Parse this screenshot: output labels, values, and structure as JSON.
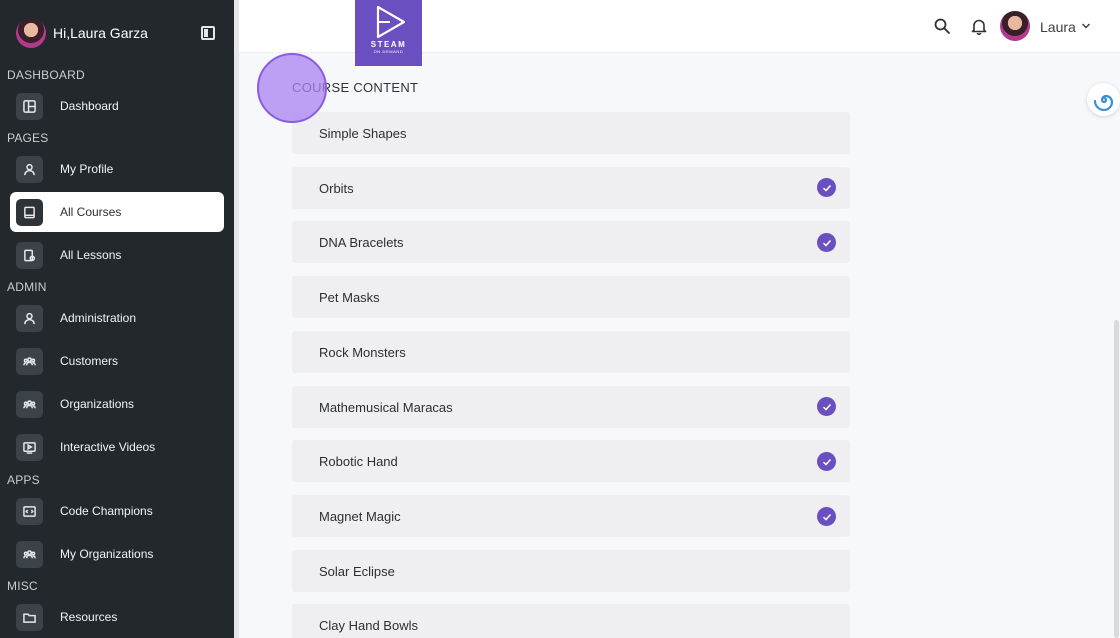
{
  "sidebar": {
    "greeting": "Hi,Laura Garza",
    "sections": {
      "dashboard": "DASHBOARD",
      "pages": "PAGES",
      "admin": "ADMIN",
      "apps": "APPS",
      "misc": "MISC"
    },
    "items": [
      {
        "label": "Dashboard",
        "icon": "dashboard-icon"
      },
      {
        "label": "My Profile",
        "icon": "user-icon"
      },
      {
        "label": "All Courses",
        "icon": "book-icon",
        "active": true
      },
      {
        "label": "All Lessons",
        "icon": "lessons-icon"
      },
      {
        "label": "Administration",
        "icon": "user-icon"
      },
      {
        "label": "Customers",
        "icon": "group-icon"
      },
      {
        "label": "Organizations",
        "icon": "group-icon"
      },
      {
        "label": "Interactive Videos",
        "icon": "video-icon"
      },
      {
        "label": "Code Champions",
        "icon": "code-icon"
      },
      {
        "label": "My Organizations",
        "icon": "group-icon"
      },
      {
        "label": "Resources",
        "icon": "folder-icon"
      }
    ]
  },
  "logo": {
    "text": "STEAM",
    "subtext": "ON DEMAND"
  },
  "header": {
    "username": "Laura"
  },
  "content": {
    "title": "COURSE CONTENT",
    "lessons": [
      {
        "label": "Simple Shapes",
        "completed": false
      },
      {
        "label": "Orbits",
        "completed": true
      },
      {
        "label": "DNA Bracelets",
        "completed": true
      },
      {
        "label": "Pet Masks",
        "completed": false
      },
      {
        "label": "Rock Monsters",
        "completed": false
      },
      {
        "label": "Mathemusical Maracas",
        "completed": true
      },
      {
        "label": "Robotic Hand",
        "completed": true
      },
      {
        "label": "Magnet Magic",
        "completed": true
      },
      {
        "label": "Solar Eclipse",
        "completed": false
      },
      {
        "label": "Clay Hand Bowls",
        "completed": false
      }
    ]
  },
  "colors": {
    "accent": "#6a4fc0",
    "sidebar": "#23282c"
  }
}
